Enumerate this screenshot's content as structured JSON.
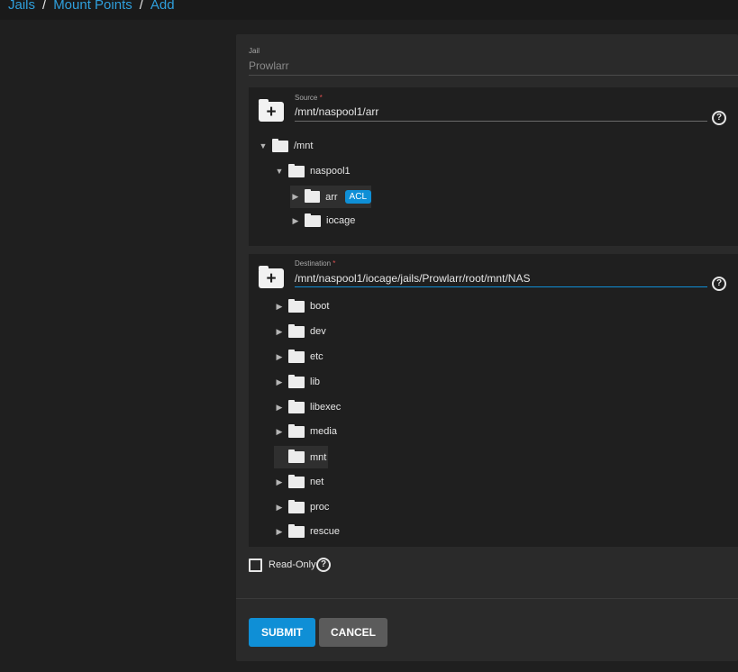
{
  "breadcrumb": {
    "item1": "Jails",
    "item2": "Mount Points",
    "item3": "Add",
    "separator": "/"
  },
  "jail": {
    "label": "Jail",
    "value": "Prowlarr"
  },
  "source": {
    "label": "Source",
    "required_mark": "*",
    "value": "/mnt/naspool1/arr",
    "tree": [
      {
        "label": "/mnt",
        "toggle": "▼"
      },
      {
        "label": "naspool1",
        "toggle": "▼"
      },
      {
        "label": "arr",
        "toggle": "▶",
        "badge": "ACL"
      },
      {
        "label": "iocage",
        "toggle": "▶"
      }
    ]
  },
  "destination": {
    "label": "Destination",
    "required_mark": "*",
    "value": "/mnt/naspool1/iocage/jails/Prowlarr/root/mnt/NAS",
    "tree": [
      {
        "label": "boot",
        "toggle": "▶"
      },
      {
        "label": "dev",
        "toggle": "▶"
      },
      {
        "label": "etc",
        "toggle": "▶"
      },
      {
        "label": "lib",
        "toggle": "▶"
      },
      {
        "label": "libexec",
        "toggle": "▶"
      },
      {
        "label": "media",
        "toggle": "▶"
      },
      {
        "label": "mnt",
        "toggle": ""
      },
      {
        "label": "net",
        "toggle": "▶"
      },
      {
        "label": "proc",
        "toggle": "▶"
      },
      {
        "label": "rescue",
        "toggle": "▶"
      }
    ]
  },
  "help_glyph": "?",
  "add_glyph": "+",
  "readonly": {
    "label": "Read-Only",
    "checked": false
  },
  "actions": {
    "submit": "SUBMIT",
    "cancel": "CANCEL"
  },
  "colors": {
    "accent": "#0f8fd6",
    "link": "#2f9fdc",
    "background": "#1f1f1f",
    "card": "#2a2a2a",
    "required": "#e05050"
  }
}
